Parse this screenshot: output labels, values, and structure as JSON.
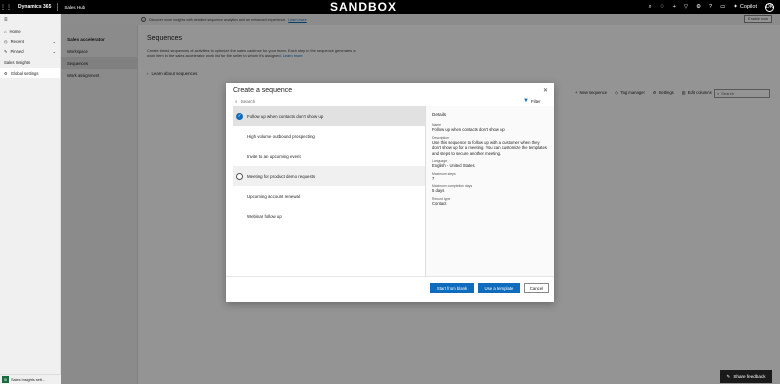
{
  "topbar": {
    "brand": "Dynamics 365",
    "app": "Sales Hub",
    "environment": "SANDBOX",
    "copilot_label": "Copilot",
    "avatar_initials": "DK"
  },
  "banner": {
    "text": "Discover more insights with detailed sequence analytics and an enhanced experience.",
    "link": "Learn more",
    "enable_label": "Enable now"
  },
  "leftnav": {
    "items": [
      {
        "label": "Home",
        "icon": "home-icon"
      },
      {
        "label": "Recent",
        "icon": "clock-icon",
        "chevron": "⌄"
      },
      {
        "label": "Pinned",
        "icon": "pin-icon",
        "chevron": "⌄"
      }
    ],
    "group": "Sales Insights",
    "selected_item": "Global settings",
    "bottom": {
      "badge": "SI",
      "label": "Sales Insights sett..."
    }
  },
  "settings": {
    "title": "Sales accelerator",
    "items": [
      "Workspace",
      "Sequences",
      "Work assignment"
    ],
    "selected": "Sequences"
  },
  "main": {
    "title": "Sequences",
    "description": "Create timed sequences of activities to optimize the sales cadence for your team. Each step in the sequence generates a work item in the sales accelerator work list for the seller to whom it's assigned.",
    "description_link": "Learn more",
    "learn_heading": "Learn about sequences",
    "toolbar": [
      "New sequence",
      "Tag manager",
      "Settings",
      "Edit columns"
    ],
    "search_placeholder": "Search"
  },
  "dialog": {
    "title": "Create a sequence",
    "search_placeholder": "Search",
    "filter_label": "Filter",
    "templates": [
      "Follow up when contacts don't show up",
      "High volume outbound prospecting",
      "Invite to an upcoming event",
      "Meeting for product demo requests",
      "Upcoming account renewal",
      "Webinar follow up"
    ],
    "details": {
      "heading": "Details",
      "fields": [
        {
          "label": "Name",
          "value": "Follow up when contacts don't show up"
        },
        {
          "label": "Description",
          "value": "Use this sequence to follow up with a customer when they don't show up for a meeting. You can customize the templates and steps to secure another meeting."
        },
        {
          "label": "Language",
          "value": "English - United States"
        },
        {
          "label": "Maximum steps",
          "value": "7"
        },
        {
          "label": "Maximum completion days",
          "value": "5 days"
        },
        {
          "label": "Record type",
          "value": "Contact"
        }
      ]
    },
    "buttons": {
      "blank": "Start from blank",
      "template": "Use a template",
      "cancel": "Cancel"
    }
  },
  "feedback_label": "Share feedback"
}
